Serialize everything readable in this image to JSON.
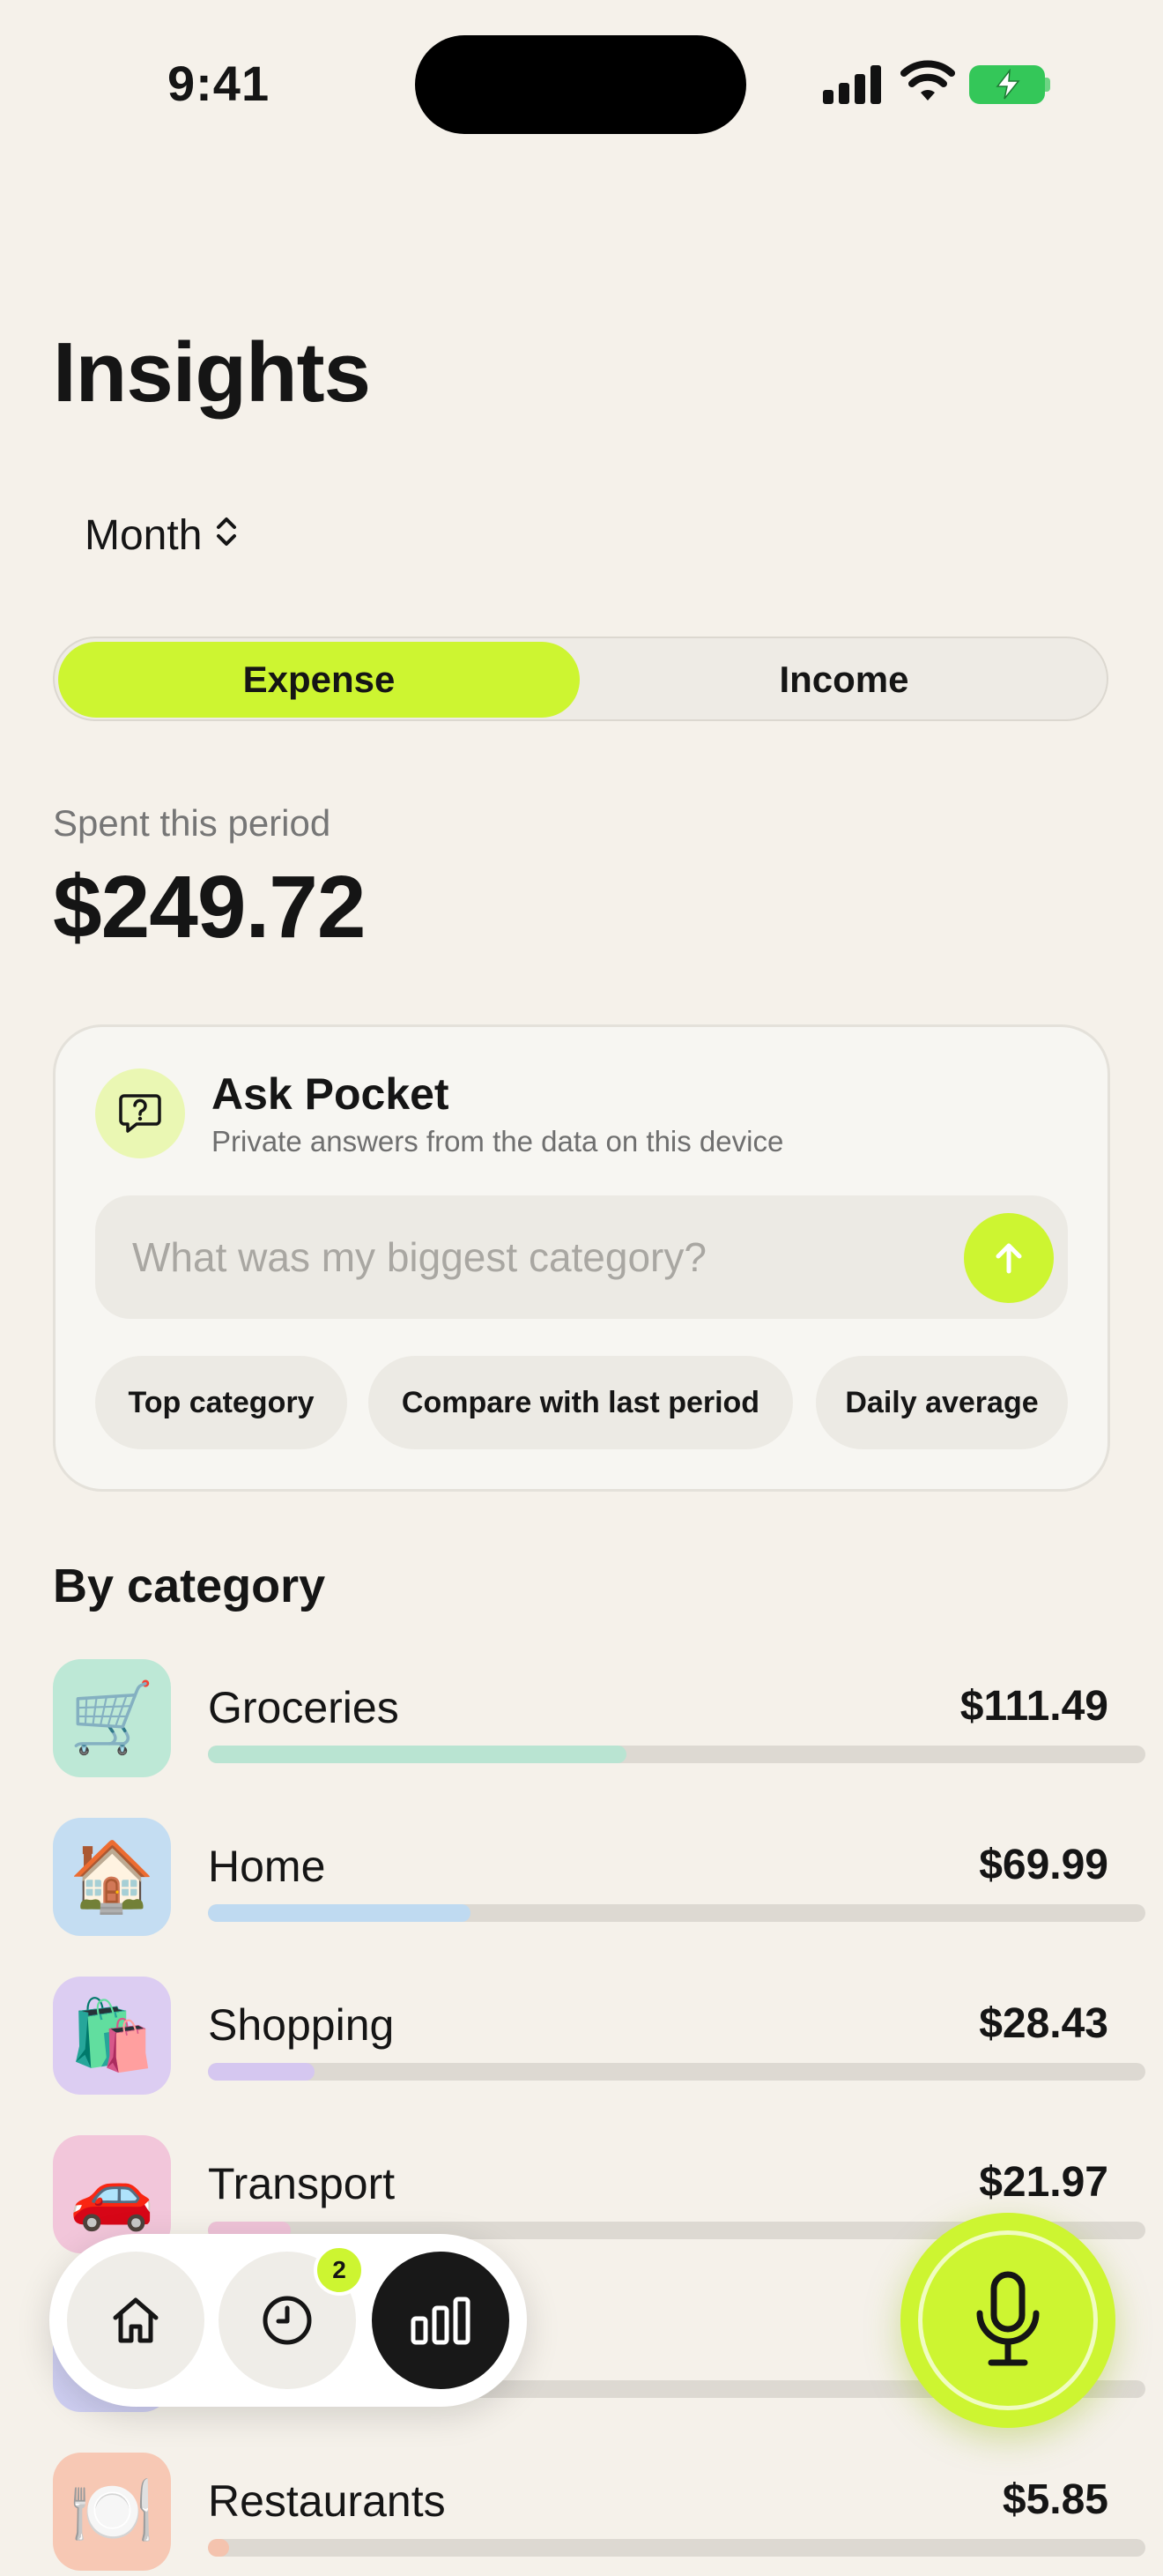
{
  "status_bar": {
    "time": "9:41"
  },
  "header": {
    "title": "Insights"
  },
  "period_picker": {
    "label": "Month"
  },
  "segment": {
    "expense_label": "Expense",
    "income_label": "Income",
    "selected": "Expense"
  },
  "summary": {
    "label": "Spent this period",
    "amount": "$249.72"
  },
  "ask": {
    "title": "Ask Pocket",
    "subtitle": "Private answers from the data on this device",
    "placeholder": "What was my biggest category?",
    "value": "",
    "chips": [
      "Top category",
      "Compare with last period",
      "Daily average"
    ]
  },
  "categories": {
    "title": "By category",
    "items": [
      {
        "name": "Groceries",
        "amount": "$111.49",
        "emoji": "🛒",
        "color": "#BDE8D6",
        "bar_color": "#B9E4D2",
        "share": 0.446
      },
      {
        "name": "Home",
        "amount": "$69.99",
        "emoji": "🏠",
        "color": "#C4DDF2",
        "bar_color": "#BFDAF1",
        "share": 0.28
      },
      {
        "name": "Shopping",
        "amount": "$28.43",
        "emoji": "🛍️",
        "color": "#DCCDF2",
        "bar_color": "#D5C7F0",
        "share": 0.114
      },
      {
        "name": "Transport",
        "amount": "$21.97",
        "emoji": "🚗",
        "color": "#F2C6DA",
        "bar_color": "#EFC3D8",
        "share": 0.088
      },
      {
        "name": "",
        "amount": "",
        "emoji": "",
        "color": "#CFCFF2",
        "bar_color": "#CBCBF0",
        "share": 0.05
      },
      {
        "name": "Restaurants",
        "amount": "$5.85",
        "emoji": "🍽️",
        "color": "#F7C8B4",
        "bar_color": "#F4C3AE",
        "share": 0.023
      }
    ]
  },
  "nav": {
    "history_badge": "2",
    "active": "insights"
  },
  "colors": {
    "accent": "#CDF531",
    "background": "#F5F1EA",
    "dark": "#181818"
  }
}
